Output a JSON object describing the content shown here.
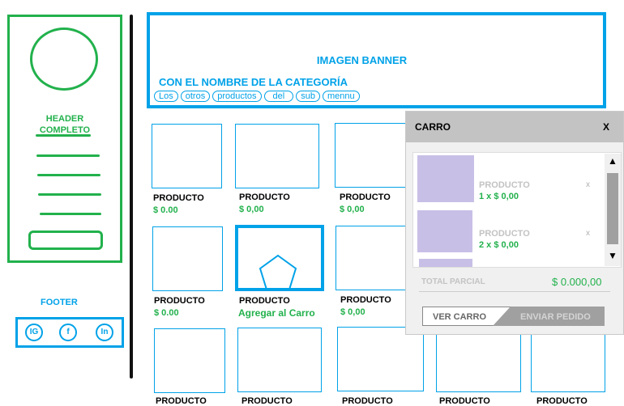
{
  "sidebar": {
    "header_text": "HEADER\nCOMPLETO"
  },
  "footer": {
    "label": "FOOTER",
    "social": [
      "IG",
      "f",
      "In"
    ]
  },
  "banner": {
    "title": "IMAGEN BANNER",
    "category": "CON EL NOMBRE DE LA CATEGORÍA",
    "tags": [
      "Los",
      "otros",
      "productos",
      "del",
      "sub",
      "mennu"
    ]
  },
  "products": {
    "row1": [
      {
        "name": "PRODUCTO",
        "price": "$ 0.00"
      },
      {
        "name": "PRODUCTO",
        "price": "$ 0,00"
      },
      {
        "name": "PRODUCTO",
        "price": "$ 0,00"
      }
    ],
    "row2": [
      {
        "name": "PRODUCTO",
        "price": "$ 0.00"
      },
      {
        "name": "PRODUCTO",
        "price": "Agregar al Carro"
      },
      {
        "name": "PRODUCTO",
        "price": "$ 0,00"
      }
    ],
    "row3": [
      {
        "name": "PRODUCTO"
      },
      {
        "name": "PRODUCTO"
      },
      {
        "name": "PRODUCTO"
      },
      {
        "name": "PRODUCTO"
      },
      {
        "name": "PRODUCTO"
      }
    ]
  },
  "cart": {
    "title": "CARRO",
    "close": "X",
    "items": [
      {
        "name": "PRODUCTO",
        "qty": "1 x $ 0,00",
        "remove": "x"
      },
      {
        "name": "PRODUCTO",
        "qty": "2 x $ 0,00",
        "remove": "x"
      }
    ],
    "scroll_up": "▲",
    "scroll_down": "▼",
    "subtotal_label": "TOTAL PARCIAL",
    "subtotal_value": "$ 0.000,00",
    "view_cart": "VER CARRO",
    "send_order": "ENVIAR PEDIDO"
  },
  "colors": {
    "green": "#22b14c",
    "blue": "#00a2e8",
    "thumb": "#c8bfe7"
  }
}
